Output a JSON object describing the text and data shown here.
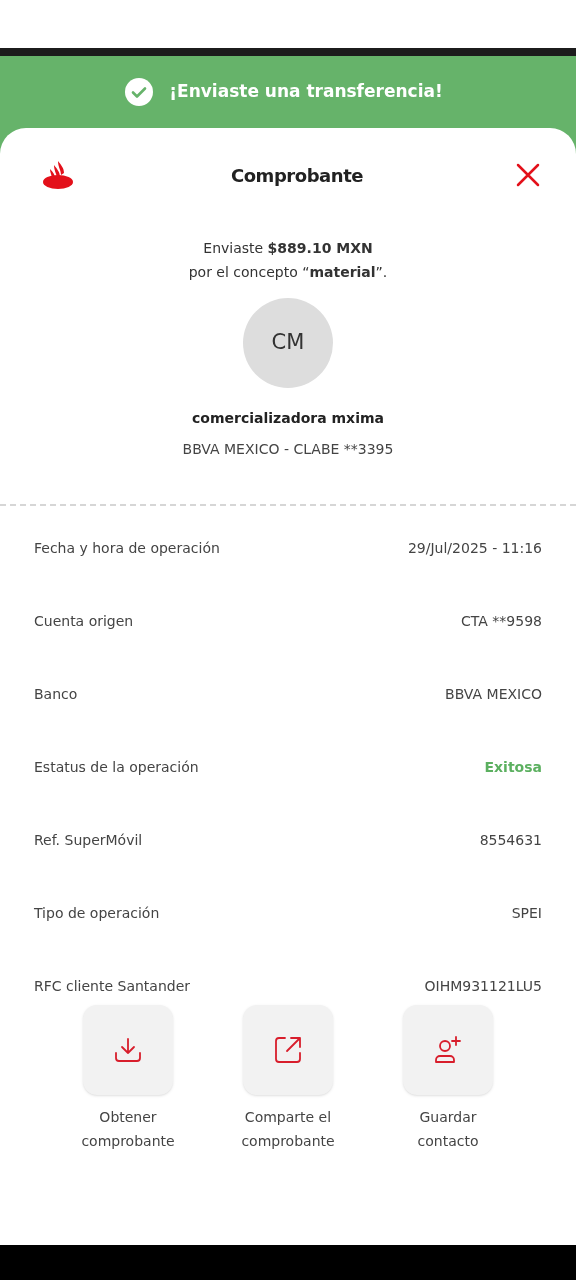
{
  "banner": {
    "text": "¡Enviaste una transferencia!"
  },
  "header": {
    "title": "Comprobante"
  },
  "summary": {
    "line_1": "Enviaste **$889.10 MXN**",
    "line_2": "por el concepto “**material**”."
  },
  "recipient": {
    "initials": "CM",
    "name": "comercializadora mxima",
    "account": "BBVA MEXICO - CLABE **3395"
  },
  "details": [
    {
      "label": "Fecha y hora de operación",
      "value": "29/Jul/2025 - 11:16",
      "kind": "plain"
    },
    {
      "label": "Cuenta origen",
      "value": "CTA **9598",
      "kind": "plain"
    },
    {
      "label": "Banco",
      "value": "BBVA MEXICO",
      "kind": "plain"
    },
    {
      "label": "Estatus de la operación",
      "value": "Exitosa",
      "kind": "success"
    },
    {
      "label": "Ref. SuperMóvil",
      "value": "8554631",
      "kind": "plain"
    },
    {
      "label": "Tipo de operación",
      "value": "SPEI",
      "kind": "plain"
    },
    {
      "label": "RFC cliente Santander",
      "value": "OIHM931121LU5",
      "kind": "plain"
    }
  ],
  "actions": [
    {
      "kind": "download",
      "line_1": "Obtener",
      "line_2": "comprobante"
    },
    {
      "kind": "share",
      "line_1": "Comparte el",
      "line_2": "comprobante"
    },
    {
      "kind": "add_contact",
      "line_1": "Guardar",
      "line_2": "contacto"
    }
  ]
}
